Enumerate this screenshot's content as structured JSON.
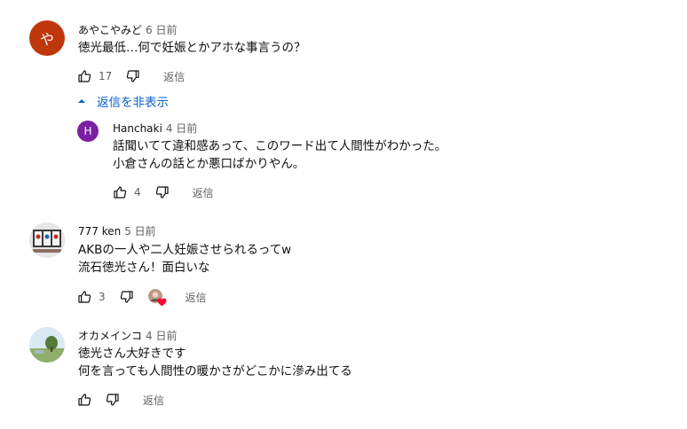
{
  "comments": [
    {
      "avatar_letter": "や",
      "avatar_color": "#c0360c",
      "author": "あやこやみど",
      "time": "6 日前",
      "lines": [
        "徳光最低…何で妊娠とかアホな事言うの？"
      ],
      "likes": "17",
      "reply_label": "返信"
    },
    {
      "avatar_letter": "H",
      "avatar_color": "#7b1fa2",
      "author": "Hanchaki",
      "time": "4 日前",
      "lines": [
        "話聞いてて違和感あって、このワード出て人間性がわかった。",
        "小倉さんの話とか悪口ばかりやん。"
      ],
      "likes": "4",
      "reply_label": "返信"
    },
    {
      "author": "777 ken",
      "time": "5 日前",
      "lines": [
        "AKBの一人や二人妊娠させられるってw",
        "流石徳光さん！面白いな"
      ],
      "likes": "3",
      "reply_label": "返信"
    },
    {
      "author": "オカメインコ",
      "time": "4 日前",
      "lines": [
        "徳光さん大好きです",
        "何を言っても人間性の暖かさがどこかに滲み出てる"
      ],
      "likes": "",
      "reply_label": "返信"
    }
  ],
  "hide_replies_label": "返信を非表示",
  "colors": {
    "link": "#065fd4",
    "heart": "#ff0033",
    "muted": "#606060"
  }
}
